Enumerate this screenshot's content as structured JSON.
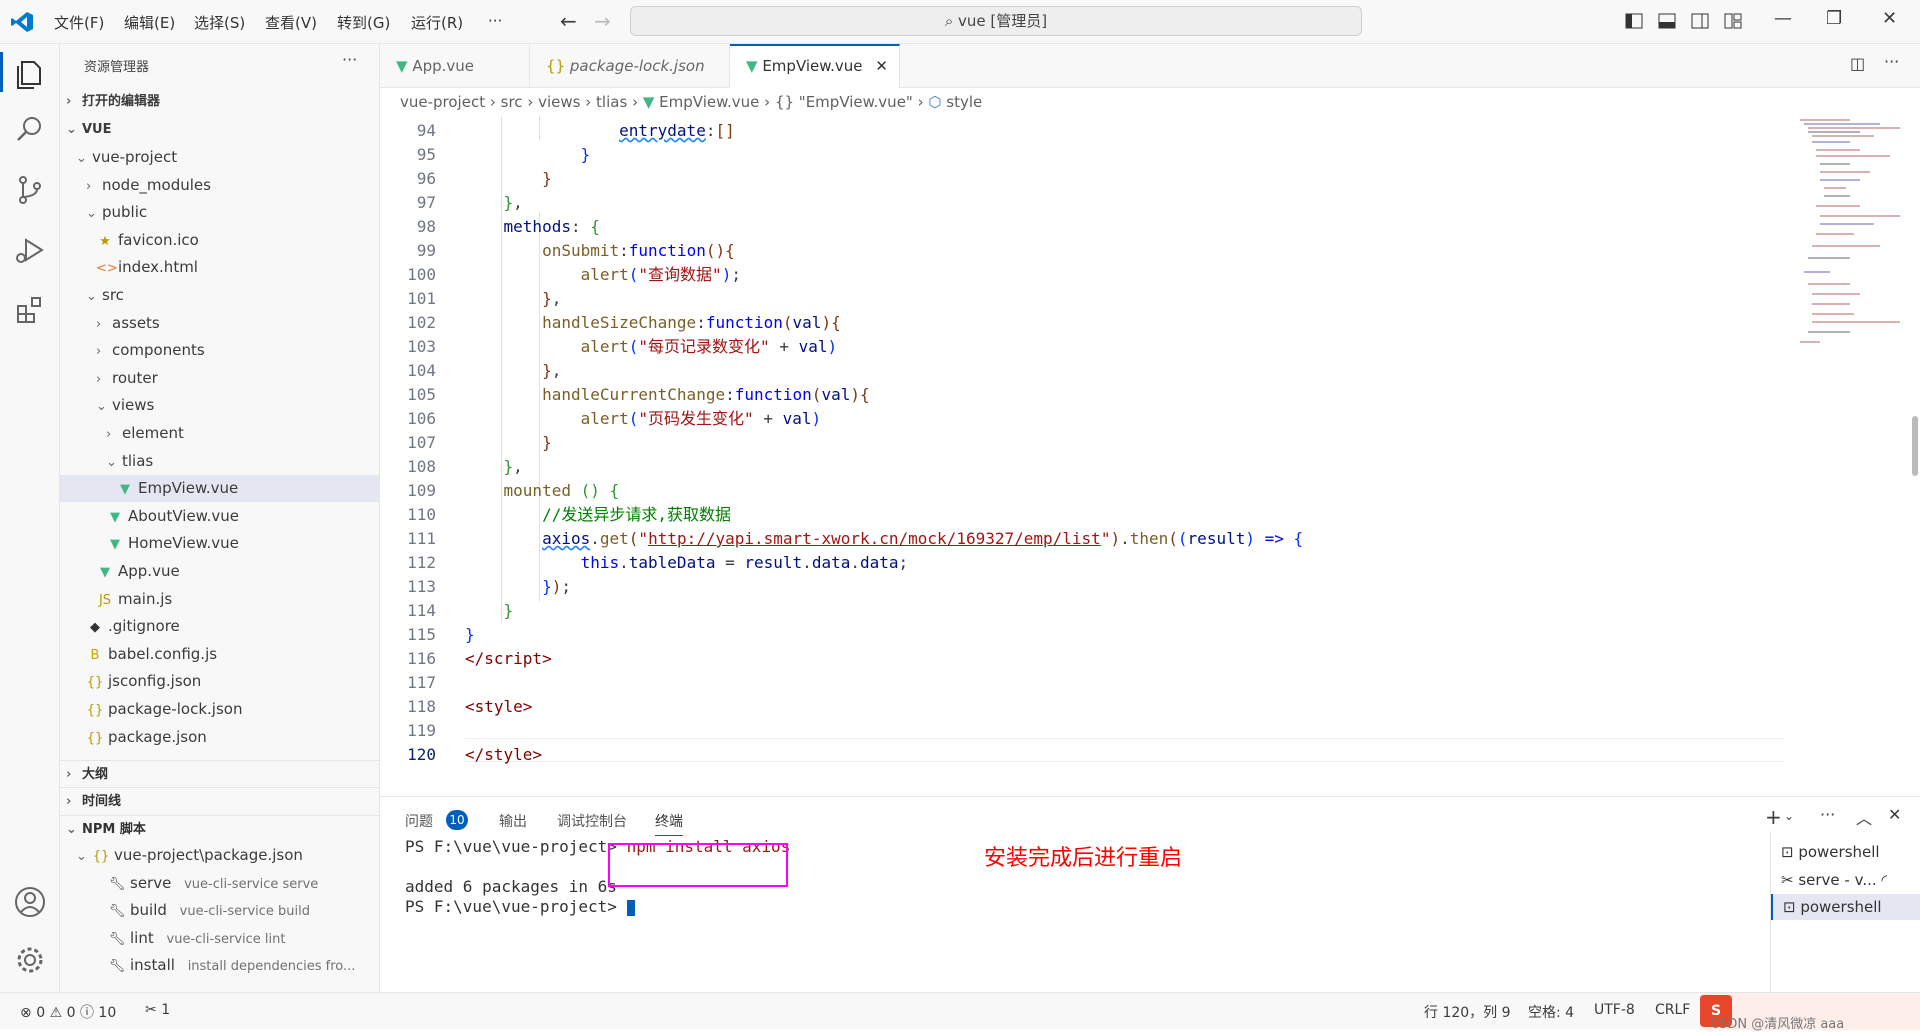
{
  "titlebar": {
    "menus": [
      "文件(F)",
      "编辑(E)",
      "选择(S)",
      "查看(V)",
      "转到(G)",
      "运行(R)",
      "···"
    ],
    "search": "vue [管理员]"
  },
  "sidebar": {
    "title": "资源管理器",
    "open_editors": "打开的编辑器",
    "workspace": "VUE",
    "tree": [
      {
        "label": "vue-project",
        "depth": 1,
        "kind": "folder-open"
      },
      {
        "label": "node_modules",
        "depth": 2,
        "kind": "folder"
      },
      {
        "label": "public",
        "depth": 2,
        "kind": "folder-open"
      },
      {
        "label": "favicon.ico",
        "depth": 3,
        "kind": "star"
      },
      {
        "label": "index.html",
        "depth": 3,
        "kind": "html"
      },
      {
        "label": "src",
        "depth": 2,
        "kind": "folder-open"
      },
      {
        "label": "assets",
        "depth": 3,
        "kind": "folder"
      },
      {
        "label": "components",
        "depth": 3,
        "kind": "folder"
      },
      {
        "label": "router",
        "depth": 3,
        "kind": "folder"
      },
      {
        "label": "views",
        "depth": 3,
        "kind": "folder-open"
      },
      {
        "label": "element",
        "depth": 4,
        "kind": "folder"
      },
      {
        "label": "tlias",
        "depth": 4,
        "kind": "folder-open"
      },
      {
        "label": "EmpView.vue",
        "depth": 5,
        "kind": "vue",
        "selected": true
      },
      {
        "label": "AboutView.vue",
        "depth": 4,
        "kind": "vue"
      },
      {
        "label": "HomeView.vue",
        "depth": 4,
        "kind": "vue"
      },
      {
        "label": "App.vue",
        "depth": 3,
        "kind": "vue"
      },
      {
        "label": "main.js",
        "depth": 3,
        "kind": "js"
      },
      {
        "label": ".gitignore",
        "depth": 2,
        "kind": "git"
      },
      {
        "label": "babel.config.js",
        "depth": 2,
        "kind": "babel"
      },
      {
        "label": "jsconfig.json",
        "depth": 2,
        "kind": "json"
      },
      {
        "label": "package-lock.json",
        "depth": 2,
        "kind": "json"
      },
      {
        "label": "package.json",
        "depth": 2,
        "kind": "json"
      }
    ],
    "outline": "大纲",
    "timeline": "时间线",
    "npm": "NPM 脚本",
    "npm_pkg": "vue-project\\package.json",
    "scripts": [
      {
        "name": "serve",
        "cmd": "vue-cli-service serve"
      },
      {
        "name": "build",
        "cmd": "vue-cli-service build"
      },
      {
        "name": "lint",
        "cmd": "vue-cli-service lint"
      },
      {
        "name": "install",
        "cmd": "install dependencies fro..."
      }
    ]
  },
  "tabs": [
    {
      "label": "App.vue"
    },
    {
      "label": "package-lock.json"
    },
    {
      "label": "EmpView.vue"
    }
  ],
  "breadcrumb": [
    "vue-project",
    "src",
    "views",
    "tlias",
    "EmpView.vue",
    "{} \"EmpView.vue\"",
    "style"
  ],
  "editor": {
    "line_numbers": [
      "94",
      "95",
      "96",
      "97",
      "98",
      "99",
      "100",
      "101",
      "102",
      "103",
      "104",
      "105",
      "106",
      "107",
      "108",
      "109",
      "110",
      "111",
      "112",
      "113",
      "114",
      "115",
      "116",
      "117",
      "118",
      "119",
      "120"
    ]
  },
  "panel": {
    "tabs": [
      "问题",
      "输出",
      "调试控制台",
      "终端"
    ],
    "problem_count": "10",
    "prompt": "PS F:\\vue\\vue-project> ",
    "command": "npm install axios",
    "output": "added 6 packages in 6s",
    "prompt2": "PS F:\\vue\\vue-project> ",
    "annotation": "安装完成后进行重启",
    "terminals": [
      "powershell",
      "serve - v...",
      "powershell"
    ]
  },
  "status": {
    "errors": "0",
    "warnings": "0",
    "infos": "10",
    "ports": "1",
    "position": "行 120，列 9",
    "spaces": "空格: 4",
    "encoding": "UTF-8",
    "eol": "CRLF",
    "watermark": "CSDN @清风微凉 aaa"
  },
  "colors": {
    "accent": "#005fb8",
    "annotation": "#ff0000",
    "highlight_box": "#ff00ff"
  }
}
